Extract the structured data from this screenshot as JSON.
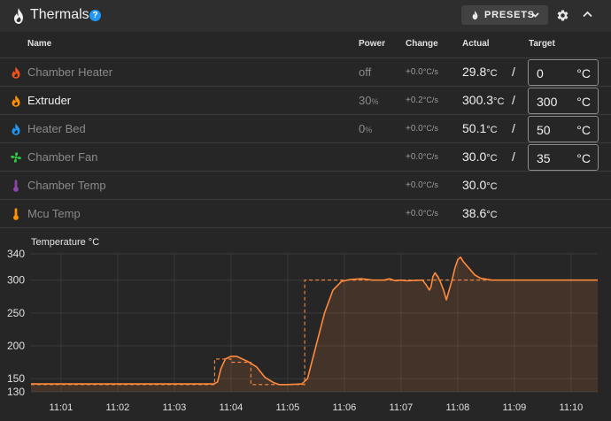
{
  "header": {
    "title": "Thermals",
    "help_label": "?",
    "presets_label": "PRESETS",
    "icons": [
      "fire-icon",
      "help-icon",
      "chevron-down-icon",
      "gear-icon",
      "chevron-up-icon"
    ]
  },
  "columns": {
    "name": "Name",
    "power": "Power",
    "change": "Change",
    "actual": "Actual",
    "target": "Target"
  },
  "rows": [
    {
      "name": "Chamber Heater",
      "icon": "fire-icon",
      "icon_color": "#f4511e",
      "power": "off",
      "power_unit": "",
      "change": "+0.0",
      "change_unit": "°C/s",
      "actual": "29.8",
      "actual_unit": "°C",
      "slash": "/",
      "target": "0",
      "target_unit": "°C",
      "active": false
    },
    {
      "name": "Extruder",
      "icon": "fire-icon",
      "icon_color": "#ff9100",
      "power": "30",
      "power_unit": "%",
      "change": "+0.2",
      "change_unit": "°C/s",
      "actual": "300.3",
      "actual_unit": "°C",
      "slash": "/",
      "target": "300",
      "target_unit": "°C",
      "active": true
    },
    {
      "name": "Heater Bed",
      "icon": "fire-icon",
      "icon_color": "#2196f3",
      "power": "0",
      "power_unit": "%",
      "change": "+0.0",
      "change_unit": "°C/s",
      "actual": "50.1",
      "actual_unit": "°C",
      "slash": "/",
      "target": "50",
      "target_unit": "°C",
      "active": false
    },
    {
      "name": "Chamber Fan",
      "icon": "fan-icon",
      "icon_color": "#2ecc40",
      "power": "",
      "power_unit": "",
      "change": "+0.0",
      "change_unit": "°C/s",
      "actual": "30.0",
      "actual_unit": "°C",
      "slash": "/",
      "target": "35",
      "target_unit": "°C",
      "active": false
    },
    {
      "name": "Chamber Temp",
      "icon": "thermometer-icon",
      "icon_color": "#8e44ad",
      "power": "",
      "power_unit": "",
      "change": "+0.0",
      "change_unit": "°C/s",
      "actual": "30.0",
      "actual_unit": "°C",
      "slash": "",
      "target": null,
      "target_unit": "",
      "active": false
    },
    {
      "name": "Mcu Temp",
      "icon": "thermometer-icon",
      "icon_color": "#ff9100",
      "power": "",
      "power_unit": "",
      "change": "+0.0",
      "change_unit": "°C/s",
      "actual": "38.6",
      "actual_unit": "°C",
      "slash": "",
      "target": null,
      "target_unit": "",
      "active": false
    }
  ],
  "chart_data": {
    "type": "line",
    "title": "Temperature °C",
    "xlabel": "",
    "ylabel": "",
    "y_ticks": [
      130,
      150,
      200,
      250,
      300,
      340
    ],
    "ylim": [
      130,
      340
    ],
    "x_ticks": [
      "11:01",
      "11:02",
      "11:03",
      "11:04",
      "11:05",
      "11:06",
      "11:07",
      "11:08",
      "11:09",
      "11:10"
    ],
    "xlim_minutes": [
      0.47,
      10.47
    ],
    "grid": true,
    "series": [
      {
        "name": "Extruder",
        "color": "#ff8a3d",
        "style": "solid-filled",
        "points": [
          [
            0.47,
            142
          ],
          [
            1.0,
            142
          ],
          [
            2.0,
            142
          ],
          [
            3.0,
            142
          ],
          [
            3.7,
            142
          ],
          [
            3.76,
            145
          ],
          [
            3.82,
            165
          ],
          [
            3.9,
            180
          ],
          [
            4.0,
            184
          ],
          [
            4.1,
            184
          ],
          [
            4.2,
            180
          ],
          [
            4.3,
            176
          ],
          [
            4.45,
            168
          ],
          [
            4.6,
            152
          ],
          [
            4.75,
            144
          ],
          [
            4.85,
            141
          ],
          [
            5.0,
            141
          ],
          [
            5.25,
            142
          ],
          [
            5.35,
            150
          ],
          [
            5.5,
            200
          ],
          [
            5.65,
            250
          ],
          [
            5.8,
            285
          ],
          [
            5.95,
            298
          ],
          [
            6.1,
            301
          ],
          [
            6.3,
            302
          ],
          [
            6.5,
            300
          ],
          [
            6.7,
            300
          ],
          [
            6.8,
            302
          ],
          [
            6.9,
            299
          ],
          [
            7.0,
            300
          ],
          [
            7.1,
            299
          ],
          [
            7.38,
            300
          ],
          [
            7.45,
            292
          ],
          [
            7.5,
            285
          ],
          [
            7.53,
            290
          ],
          [
            7.56,
            305
          ],
          [
            7.6,
            311
          ],
          [
            7.65,
            305
          ],
          [
            7.7,
            296
          ],
          [
            7.75,
            285
          ],
          [
            7.8,
            270
          ],
          [
            7.85,
            285
          ],
          [
            7.9,
            300
          ],
          [
            7.95,
            318
          ],
          [
            8.0,
            331
          ],
          [
            8.05,
            335
          ],
          [
            8.1,
            328
          ],
          [
            8.2,
            318
          ],
          [
            8.3,
            308
          ],
          [
            8.4,
            303
          ],
          [
            8.6,
            300
          ],
          [
            9.0,
            300
          ],
          [
            9.5,
            300
          ],
          [
            10.0,
            300
          ],
          [
            10.47,
            300
          ]
        ]
      },
      {
        "name": "Extruder Target",
        "color": "#ff8a3d",
        "style": "dashed",
        "points": [
          [
            0.47,
            141
          ],
          [
            3.71,
            141
          ],
          [
            3.71,
            180
          ],
          [
            4.0,
            180
          ],
          [
            4.0,
            175
          ],
          [
            4.35,
            175
          ],
          [
            4.35,
            141
          ],
          [
            5.3,
            141
          ],
          [
            5.3,
            300
          ],
          [
            10.47,
            300
          ]
        ]
      }
    ]
  }
}
